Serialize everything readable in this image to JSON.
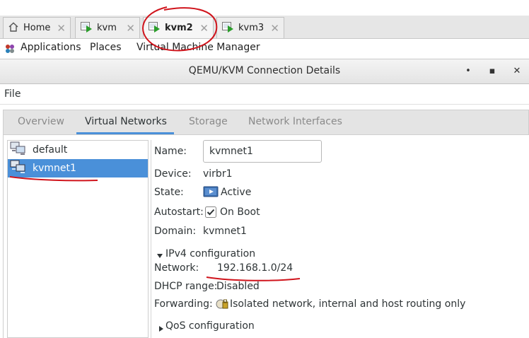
{
  "client_tabs": [
    {
      "label": "Home",
      "icon": "home-icon"
    },
    {
      "label": "kvm",
      "icon": "vm-console-icon"
    },
    {
      "label": "kvm2",
      "icon": "vm-console-icon"
    },
    {
      "label": "kvm3",
      "icon": "vm-console-icon"
    }
  ],
  "panel": {
    "applications": "Applications",
    "places": "Places",
    "vmm": "Virtual Machine Manager"
  },
  "window": {
    "title": "QEMU/KVM Connection Details",
    "minimize": "•",
    "maximize": "▪",
    "close": "✕"
  },
  "menu": {
    "file": "File"
  },
  "notebook_tabs": [
    "Overview",
    "Virtual Networks",
    "Storage",
    "Network Interfaces"
  ],
  "networks": [
    "default",
    "kvmnet1"
  ],
  "details": {
    "name_label": "Name:",
    "name_value": "kvmnet1",
    "device_label": "Device:",
    "device_value": "virbr1",
    "state_label": "State:",
    "state_value": "Active",
    "autostart_label": "Autostart:",
    "autostart_value": "On Boot",
    "domain_label": "Domain:",
    "domain_value": "kvmnet1",
    "ipv4_header": "IPv4 configuration",
    "network_label": "Network:",
    "network_value": "192.168.1.0/24",
    "dhcp_label": "DHCP range:",
    "dhcp_value": "Disabled",
    "forwarding_label": "Forwarding:",
    "forwarding_value": "Isolated network, internal and host routing only",
    "qos_header": "QoS configuration"
  },
  "colors": {
    "selection": "#4a90d9",
    "annotation": "#d0141c",
    "play": "#2a9d2a"
  }
}
